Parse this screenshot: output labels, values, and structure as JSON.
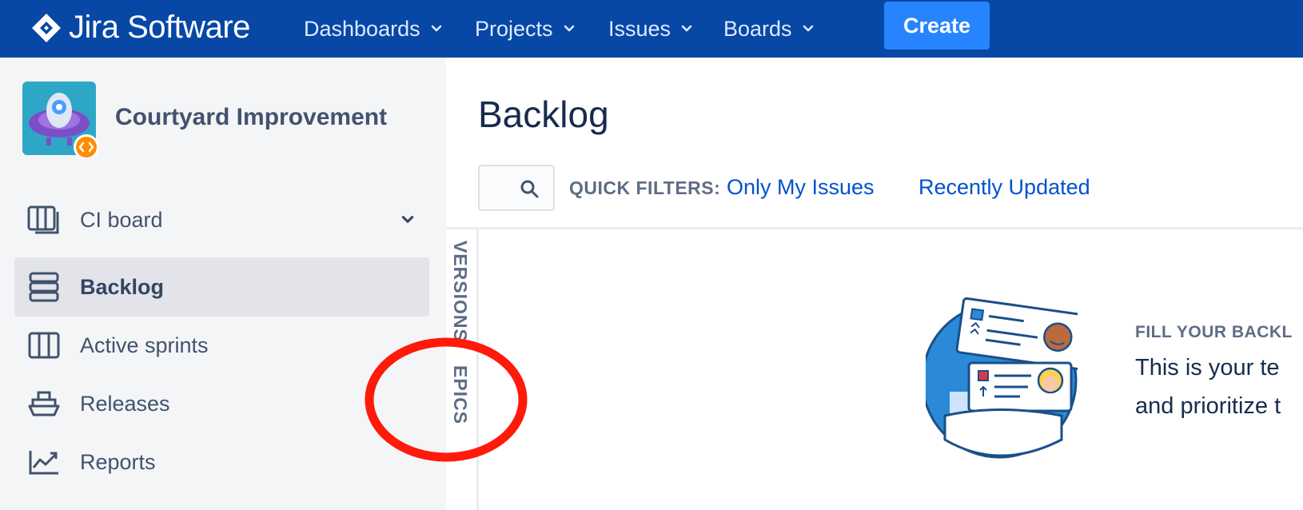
{
  "app": {
    "name": "Jira Software",
    "colors": {
      "nav_bg": "#0747a6",
      "create_bg": "#2684ff",
      "link": "#0052cc",
      "annotation": "#ff1a0a"
    }
  },
  "topnav": {
    "items": [
      {
        "label": "Dashboards",
        "icon": "chevron-down-icon"
      },
      {
        "label": "Projects",
        "icon": "chevron-down-icon"
      },
      {
        "label": "Issues",
        "icon": "chevron-down-icon"
      },
      {
        "label": "Boards",
        "icon": "chevron-down-icon"
      }
    ],
    "create_label": "Create"
  },
  "sidebar": {
    "project_name": "Courtyard Improvement",
    "board": {
      "label": "CI board",
      "icon": "board-icon"
    },
    "items": [
      {
        "label": "Backlog",
        "icon": "backlog-icon",
        "active": true
      },
      {
        "label": "Active sprints",
        "icon": "sprints-icon",
        "active": false
      },
      {
        "label": "Releases",
        "icon": "ship-icon",
        "active": false
      },
      {
        "label": "Reports",
        "icon": "chart-icon",
        "active": false
      }
    ]
  },
  "main": {
    "title": "Backlog",
    "quick_filters_label": "QUICK FILTERS:",
    "quick_filters": [
      "Only My Issues",
      "Recently Updated"
    ],
    "side_tabs": [
      "VERSIONS",
      "EPICS"
    ],
    "empty_state": {
      "heading": "FILL YOUR BACKL",
      "line1": "This is your te",
      "line2": "and prioritize t"
    }
  }
}
